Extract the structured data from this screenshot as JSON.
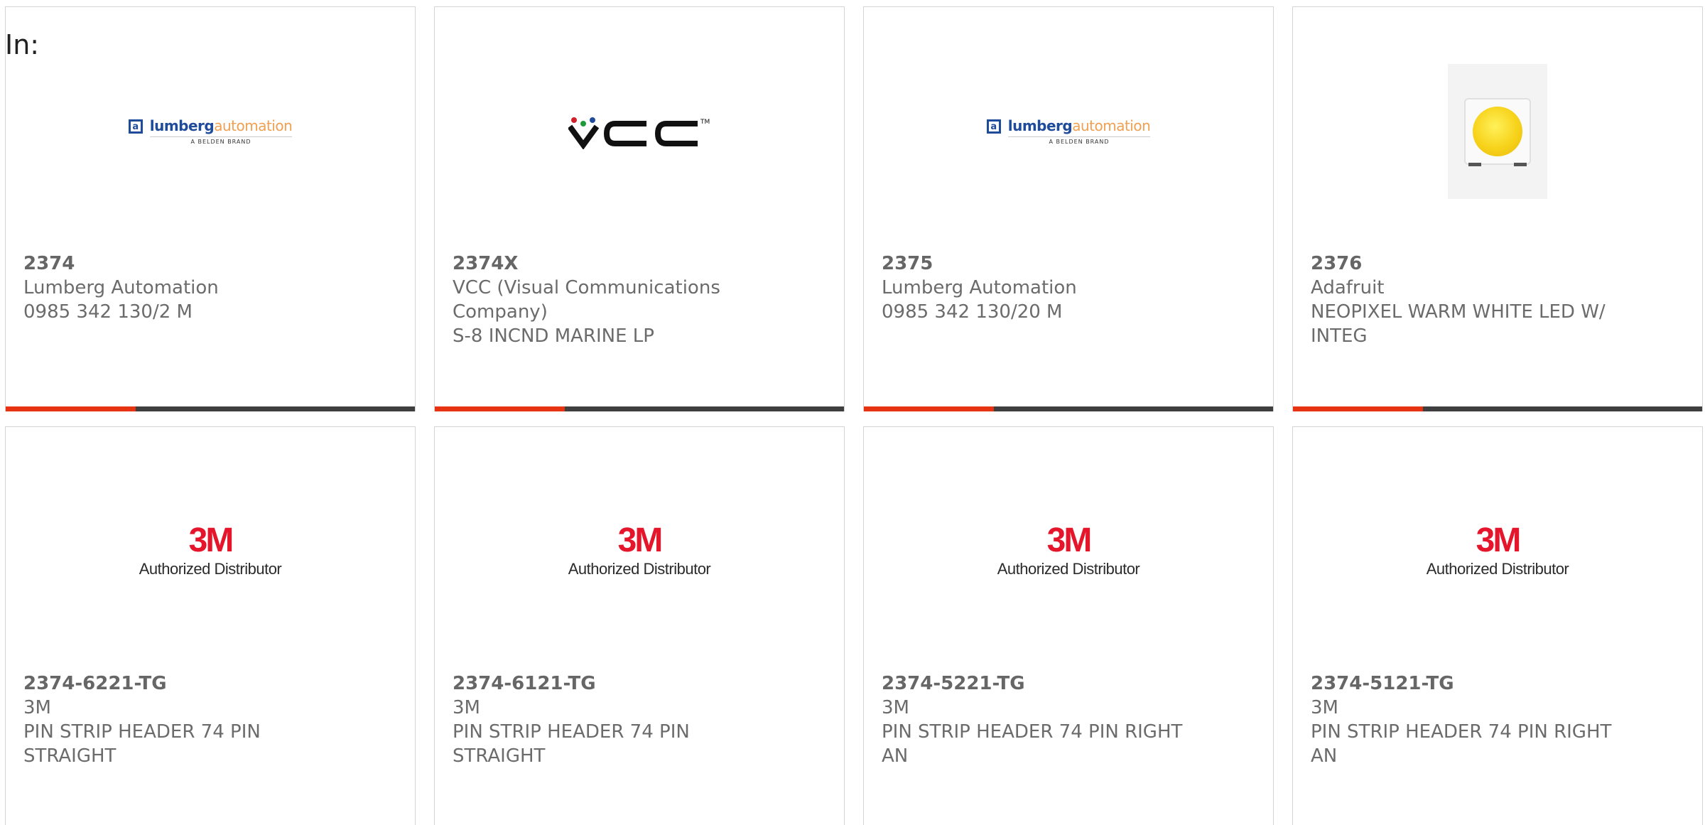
{
  "header": {
    "in_label": "In:"
  },
  "products": [
    {
      "part_number": "2374",
      "manufacturer": "Lumberg Automation",
      "description": "0985 342 130/2 M",
      "logo": "lumberg-automation-logo"
    },
    {
      "part_number": "2374X",
      "manufacturer": "VCC (Visual Communications Company)",
      "description": "S-8 INCND MARINE LP",
      "logo": "vcc-logo"
    },
    {
      "part_number": "2375",
      "manufacturer": "Lumberg Automation",
      "description": "0985 342 130/20 M",
      "logo": "lumberg-automation-logo"
    },
    {
      "part_number": "2376",
      "manufacturer": "Adafruit",
      "description": "NEOPIXEL WARM WHITE LED W/ INTEG",
      "logo": "led-product-photo"
    },
    {
      "part_number": "2374-6221-TG",
      "manufacturer": "3M",
      "description": "PIN STRIP HEADER 74 PIN STRAIGHT",
      "logo": "3m-authorized-distributor-logo"
    },
    {
      "part_number": "2374-6121-TG",
      "manufacturer": "3M",
      "description": "PIN STRIP HEADER 74 PIN STRAIGHT",
      "logo": "3m-authorized-distributor-logo"
    },
    {
      "part_number": "2374-5221-TG",
      "manufacturer": "3M",
      "description": "PIN STRIP HEADER 74 PIN RIGHT AN",
      "logo": "3m-authorized-distributor-logo"
    },
    {
      "part_number": "2374-5121-TG",
      "manufacturer": "3M",
      "description": "PIN STRIP HEADER 74 PIN RIGHT AN",
      "logo": "3m-authorized-distributor-logo"
    }
  ],
  "logos": {
    "lumberg_brand": "lumberg",
    "lumberg_suffix": "automation",
    "lumberg_tagline": "A BELDEN BRAND",
    "threem_mark": "3M",
    "threem_caption": "Authorized Distributor"
  },
  "colors": {
    "accent": "#e63312",
    "bar": "#3f3f3f",
    "text": "#6b6b6b",
    "threem_red": "#e5162b",
    "lumberg_blue": "#1f4c9a",
    "lumberg_orange": "#f0a050"
  }
}
